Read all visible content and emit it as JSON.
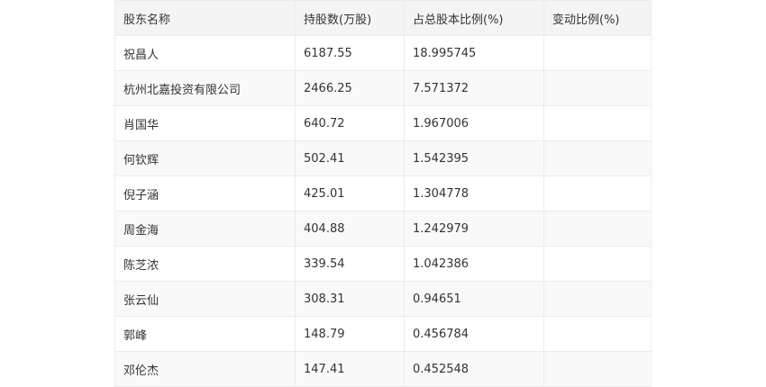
{
  "table": {
    "headers": [
      "股东名称",
      "持股数(万股)",
      "占总股本比例(%)",
      "变动比例(%)"
    ],
    "rows": [
      {
        "name": "祝昌人",
        "shares": "6187.55",
        "ratio": "18.995745",
        "change": ""
      },
      {
        "name": "杭州北嘉投资有限公司",
        "shares": "2466.25",
        "ratio": "7.571372",
        "change": ""
      },
      {
        "name": "肖国华",
        "shares": "640.72",
        "ratio": "1.967006",
        "change": ""
      },
      {
        "name": "何钦辉",
        "shares": "502.41",
        "ratio": "1.542395",
        "change": ""
      },
      {
        "name": "倪子涵",
        "shares": "425.01",
        "ratio": "1.304778",
        "change": ""
      },
      {
        "name": "周金海",
        "shares": "404.88",
        "ratio": "1.242979",
        "change": ""
      },
      {
        "name": "陈芝浓",
        "shares": "339.54",
        "ratio": "1.042386",
        "change": ""
      },
      {
        "name": "张云仙",
        "shares": "308.31",
        "ratio": "0.94651",
        "change": ""
      },
      {
        "name": "郭峰",
        "shares": "148.79",
        "ratio": "0.456784",
        "change": ""
      },
      {
        "name": "邓伦杰",
        "shares": "147.41",
        "ratio": "0.452548",
        "change": ""
      }
    ]
  }
}
